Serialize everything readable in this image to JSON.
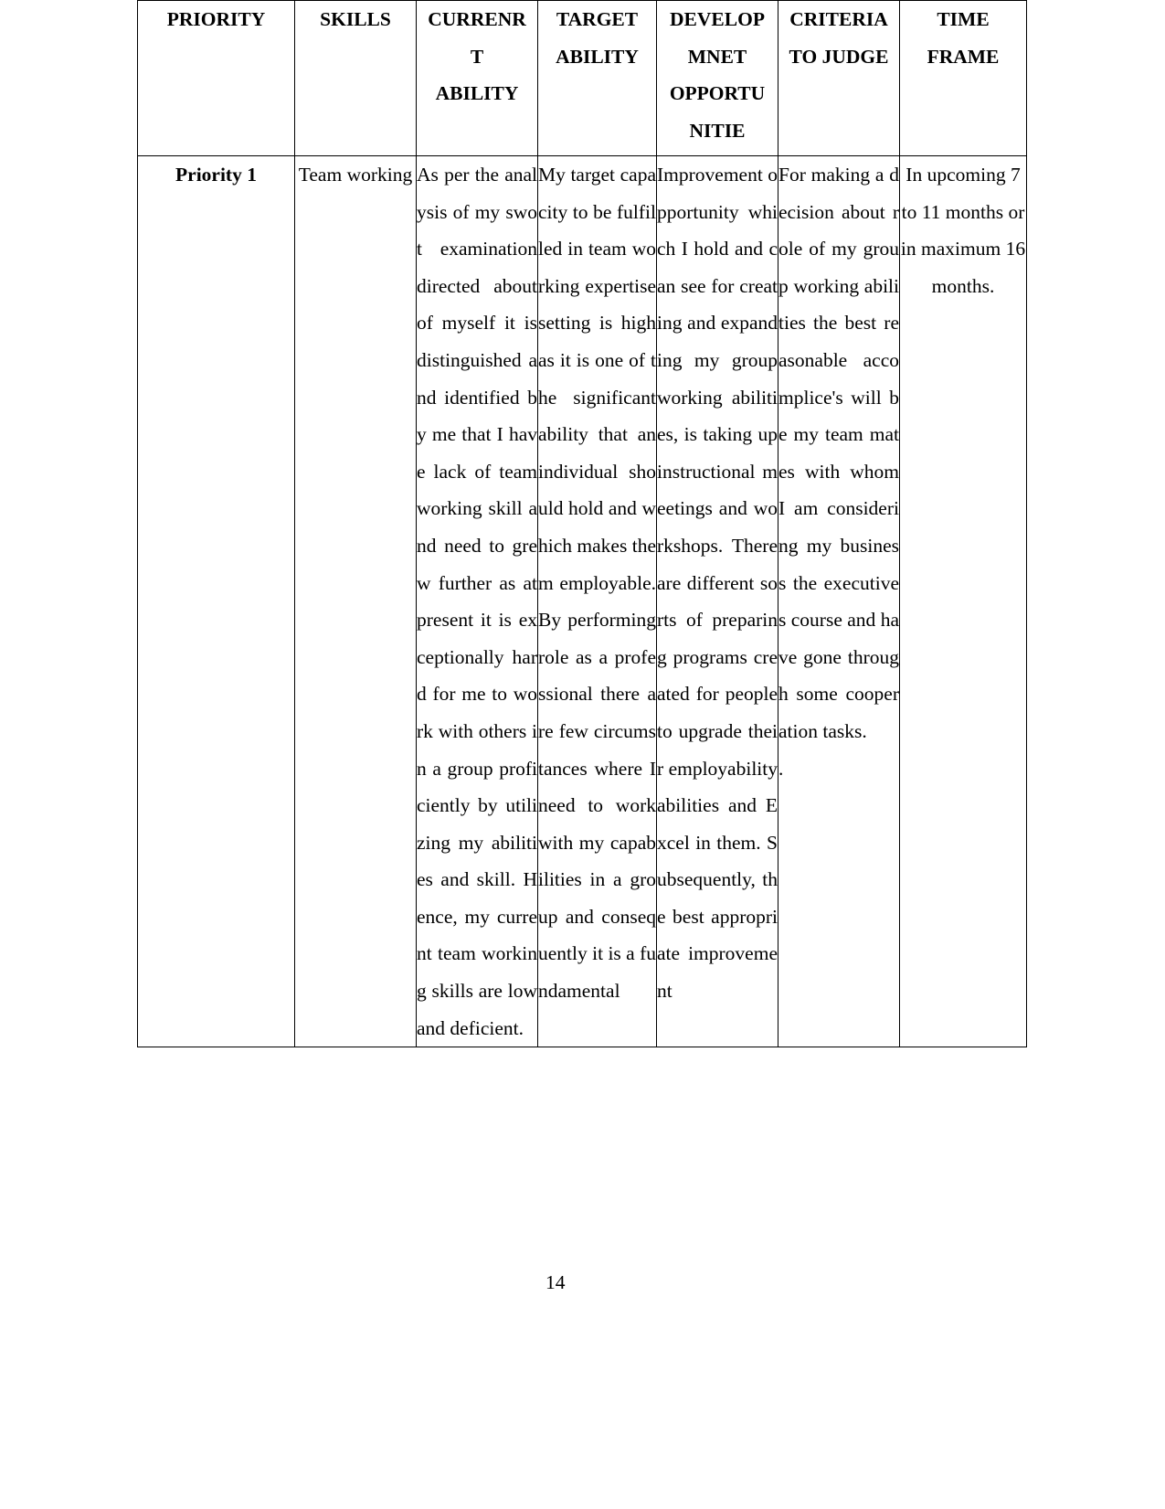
{
  "document": {
    "page_number": "14"
  },
  "table": {
    "headers": [
      "PRIORITY",
      "SKILLS",
      "CURRENRT ABILITY",
      "TARGET ABILITY",
      "DEVELOPMNET OPPORTUNITIE",
      "CRITERIA TO JUDGE",
      "TIME FRAME"
    ],
    "header_lines": {
      "priority": "PRIORITY",
      "skills": "SKILLS",
      "current_ability_l1": "CURRENR",
      "current_ability_l2": "T",
      "current_ability_l3": "ABILITY",
      "target_ability_l1": "TARGET",
      "target_ability_l2": "ABILITY",
      "development_l1": "DEVELOP",
      "development_l2": "MNET",
      "development_l3": "OPPORTU",
      "development_l4": "NITIE",
      "criteria_l1": "CRITERIA",
      "criteria_l2": "TO JUDGE",
      "time_l1": "TIME",
      "time_l2": "FRAME"
    },
    "rows": [
      {
        "priority": "Priority 1",
        "skills": "Team working",
        "current_ability": "As per the analysis of my swot examination directed about of myself it is distinguished and identified by me that I have lack of team working skill and need to grew further as at present it is exceptionally hard for me to work with others in a group proficiently by utilizing my abilities and skill. Hence, my current team working skills are low and deficient.",
        "target_ability": "My target capacity to be fulfilled in team working expertise setting is high as it is one of the significant ability that an individual should hold and which makes them employable. By performing role as a professional there are few circumstances where I need to work with my capabilities in a group and consequently it is a fundamental",
        "development_opportunity": "Improvement opportunity which I hold and can see for creating and expanding my group working abilities, is taking up instructional meetings and workshops. There are different sorts of preparing programs created for people to upgrade their employability abilities and Excel in them. Subsequently, the best appropriate improvement",
        "criteria_to_judge": "For making a decision about role of my group working abilities the best reasonable accomplice's will be my team mates with whom I am considering my business the executives course and have gone through some cooperation tasks.",
        "criteria_stray_mark": ".",
        "time_frame": "In upcoming 7 to 11 months or in maximum 16 months."
      }
    ]
  }
}
